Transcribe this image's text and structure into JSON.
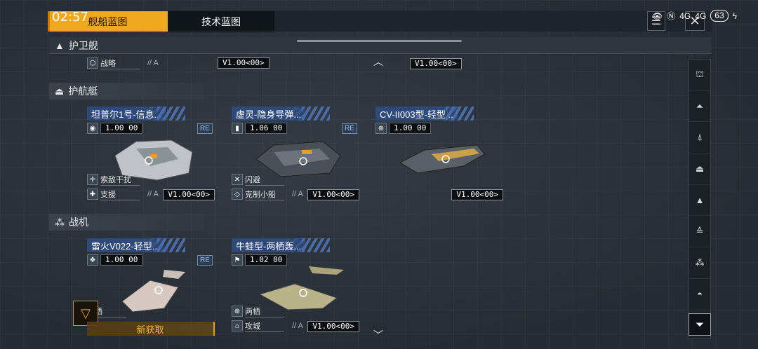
{
  "tabs": [
    {
      "label": "舰船蓝图"
    },
    {
      "label": "技术蓝图"
    }
  ],
  "status": {
    "time": "02:57",
    "signal1": "4G",
    "signal2": "4G",
    "battery": "63"
  },
  "categories": [
    {
      "label": "护卫舰",
      "partial_tag": "战略",
      "partial_grade": "// A",
      "partial_version": "V1.00<00>"
    },
    {
      "label": "护航艇"
    },
    {
      "label": "战机"
    }
  ],
  "cards": [
    {
      "name": "坦普尔1号-信息...",
      "cost": "1.00 00",
      "badge": "RE",
      "tag1": "索敌干扰",
      "tag2": "支援",
      "grade": "// A",
      "version": "V1.00<00>"
    },
    {
      "name": "虚灵-隐身导弹...",
      "cost": "1.06 00",
      "badge": "RE",
      "tag1": "闪避",
      "tag2": "克制小船",
      "grade": "// A",
      "version": "V1.00<00>"
    },
    {
      "name": "CV-II003型-轻型...",
      "cost": "1.00 00",
      "version": "V1.00<00>"
    },
    {
      "name": "雷火V022-轻型...",
      "cost": "1.00 00",
      "badge": "RE",
      "tag1": "两栖"
    },
    {
      "name": "牛蛙型-两栖轰...",
      "cost": "1.02 00",
      "tag1": "两栖",
      "tag2": "攻城",
      "grade": "// A",
      "version": "V1.00<00>"
    }
  ],
  "new_label": "新获取"
}
